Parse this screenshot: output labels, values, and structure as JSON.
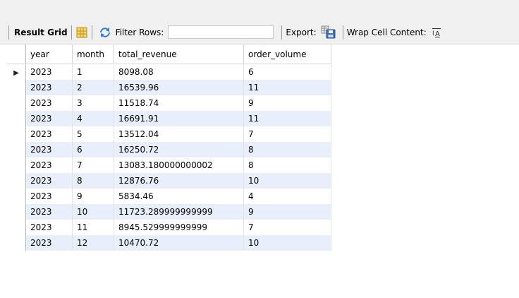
{
  "toolbar": {
    "result_grid_label": "Result Grid",
    "filter_rows_label": "Filter Rows:",
    "filter_value": "",
    "export_label": "Export:",
    "wrap_label": "Wrap Cell Content:"
  },
  "icons": {
    "grid_icon": "form-grid-icon",
    "refresh_icon": "refresh-arrows-icon",
    "export_icon": "save-disk-icon",
    "wrap_icon": "wrap-text-icon"
  },
  "columns": [
    "year",
    "month",
    "total_revenue",
    "order_volume"
  ],
  "rows": [
    [
      "2023",
      "1",
      "8098.08",
      "6"
    ],
    [
      "2023",
      "2",
      "16539.96",
      "11"
    ],
    [
      "2023",
      "3",
      "11518.74",
      "9"
    ],
    [
      "2023",
      "4",
      "16691.91",
      "11"
    ],
    [
      "2023",
      "5",
      "13512.04",
      "7"
    ],
    [
      "2023",
      "6",
      "16250.72",
      "8"
    ],
    [
      "2023",
      "7",
      "13083.180000000002",
      "8"
    ],
    [
      "2023",
      "8",
      "12876.76",
      "10"
    ],
    [
      "2023",
      "9",
      "5834.46",
      "4"
    ],
    [
      "2023",
      "10",
      "11723.289999999999",
      "9"
    ],
    [
      "2023",
      "11",
      "8945.529999999999",
      "7"
    ],
    [
      "2023",
      "12",
      "10470.72",
      "10"
    ]
  ],
  "current_row_index": 0
}
